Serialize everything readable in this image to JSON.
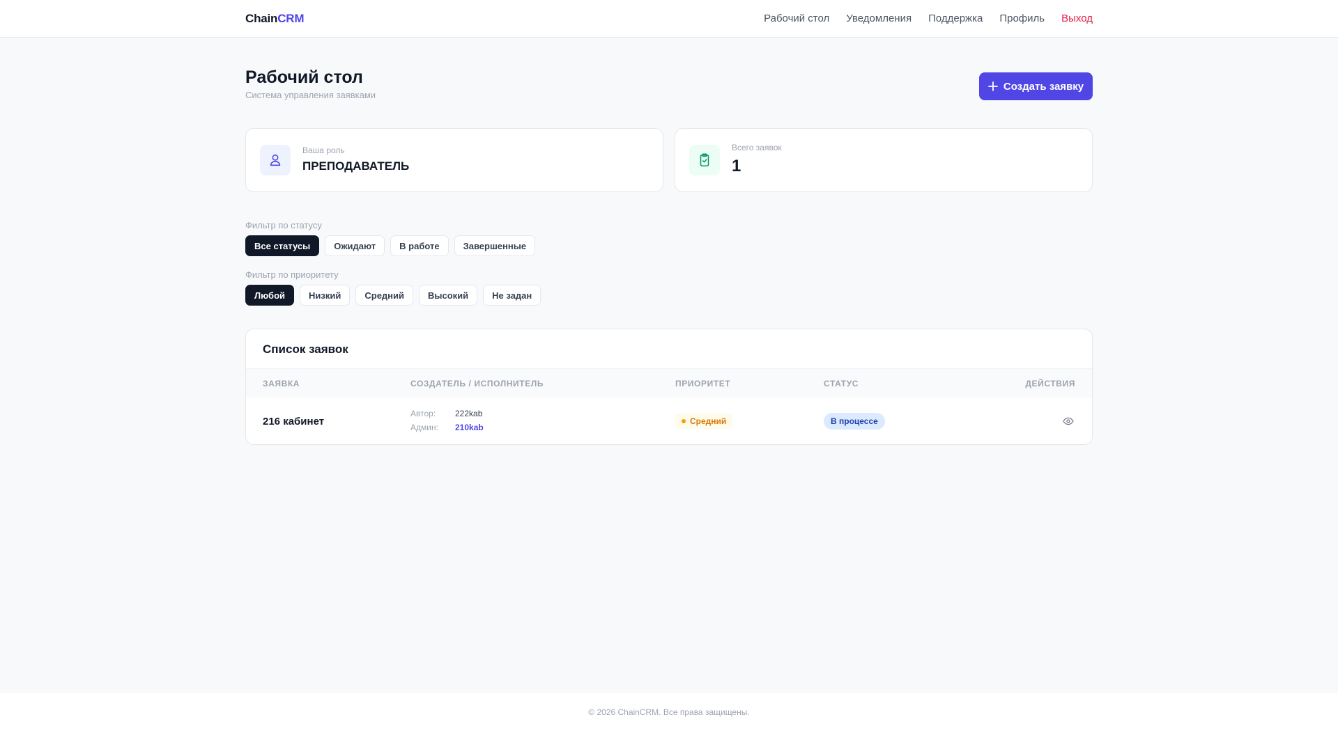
{
  "header": {
    "brand_prefix": "Chain",
    "brand_accent": "CRM",
    "nav": [
      {
        "label": "Рабочий стол"
      },
      {
        "label": "Уведомления"
      },
      {
        "label": "Поддержка"
      },
      {
        "label": "Профиль"
      },
      {
        "label": "Выход"
      }
    ]
  },
  "page": {
    "title": "Рабочий стол",
    "subtitle": "Система управления заявками",
    "create_button": "Создать заявку"
  },
  "stats": {
    "role_label": "Ваша роль",
    "role_value": "ПРЕПОДАВАТЕЛЬ",
    "role_icon": "user-icon",
    "total_label": "Всего заявок",
    "total_value": "1",
    "total_icon": "clipboard-check-icon"
  },
  "filters": {
    "status_label": "Фильтр по статусу",
    "status_options": [
      "Все статусы",
      "Ожидают",
      "В работе",
      "Завершенные"
    ],
    "status_selected": "Все статусы",
    "priority_label": "Фильтр по приоритету",
    "priority_options": [
      "Любой",
      "Низкий",
      "Средний",
      "Высокий",
      "Не задан"
    ],
    "priority_selected": "Любой"
  },
  "table": {
    "title": "Список заявок",
    "columns": [
      "ЗАЯВКА",
      "СОЗДАТЕЛЬ / ИСПОЛНИТЕЛЬ",
      "ПРИОРИТЕТ",
      "СТАТУС",
      "ДЕЙСТВИЯ"
    ],
    "rows": [
      {
        "title": "216 кабинет",
        "author_label": "Автор:",
        "author": "222kab",
        "admin_label": "Админ:",
        "admin": "210kab",
        "priority": "Средний",
        "status": "В процессе",
        "action_icon": "eye-icon"
      }
    ]
  },
  "colors": {
    "accent": "#4f46e5",
    "logout": "#e11d48",
    "priority_medium": "#d97706",
    "status_in_progress": "#1e40af"
  },
  "footer": {
    "text": "© 2026 ChainCRM. Все права защищены."
  }
}
